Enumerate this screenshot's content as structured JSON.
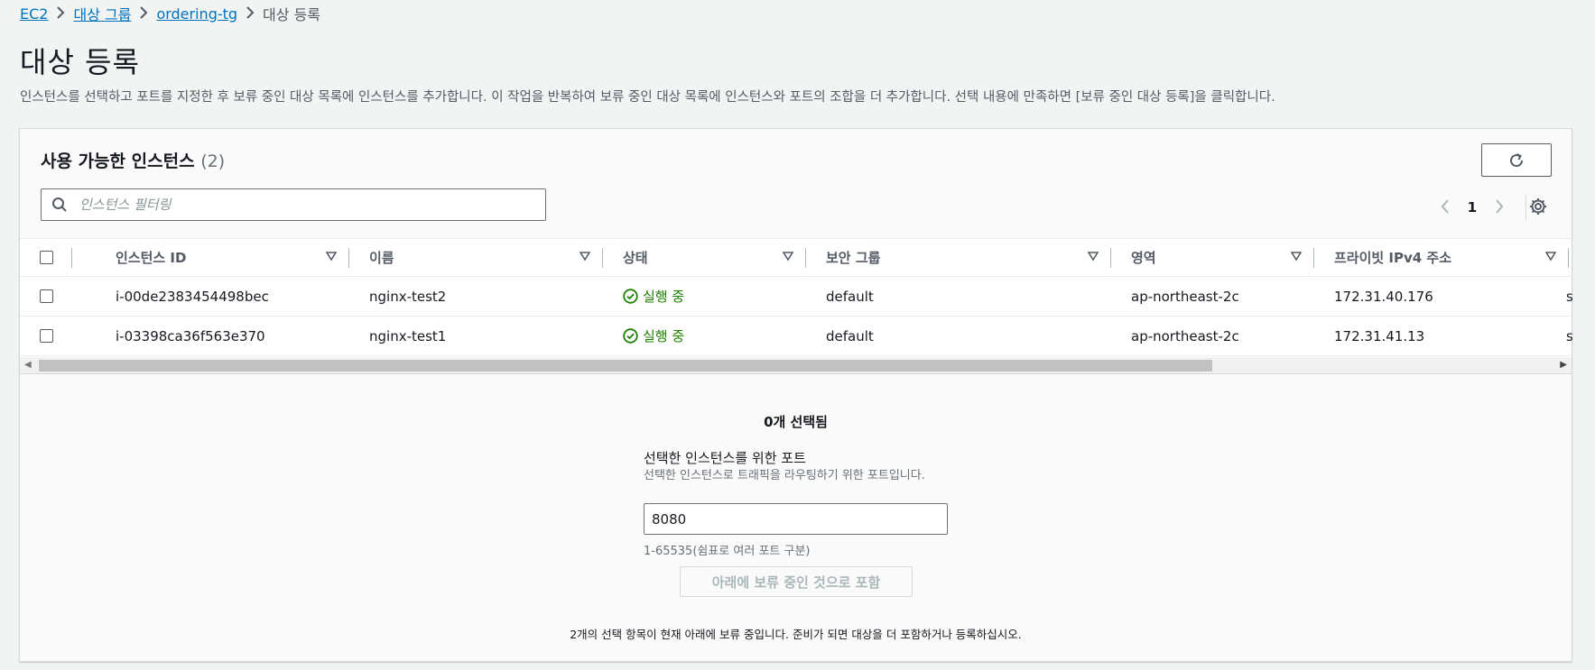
{
  "breadcrumb": {
    "items": [
      "EC2",
      "대상 그룹",
      "ordering-tg"
    ],
    "current": "대상 등록"
  },
  "page": {
    "title": "대상 등록",
    "description": "인스턴스를 선택하고 포트를 지정한 후 보류 중인 대상 목록에 인스턴스를 추가합니다. 이 작업을 반복하여 보류 중인 대상 목록에 인스턴스와 포트의 조합을 더 추가합니다. 선택 내용에 만족하면 [보류 중인 대상 등록]을 클릭합니다."
  },
  "panel": {
    "title": "사용 가능한 인스턴스",
    "count": "(2)",
    "search_placeholder": "인스턴스 필터링",
    "page_number": "1"
  },
  "table": {
    "columns": [
      "인스턴스 ID",
      "이름",
      "상태",
      "보안 그룹",
      "영역",
      "프라이빗 IPv4 주소"
    ],
    "rows": [
      {
        "id": "i-00de2383454498bec",
        "name": "nginx-test2",
        "state": "실행 중",
        "sg": "default",
        "zone": "ap-northeast-2c",
        "ip": "172.31.40.176",
        "extra": "s"
      },
      {
        "id": "i-03398ca36f563e370",
        "name": "nginx-test1",
        "state": "실행 중",
        "sg": "default",
        "zone": "ap-northeast-2c",
        "ip": "172.31.41.13",
        "extra": "s"
      }
    ]
  },
  "selection": {
    "selected_count": "0개 선택됨",
    "port_label": "선택한 인스턴스를 위한 포트",
    "port_desc": "선택한 인스턴스로 트래픽을 라우팅하기 위한 포트입니다.",
    "port_value": "8080",
    "port_hint": "1-65535(쉼표로 여러 포트 구분)",
    "include_button": "아래에 보류 중인 것으로 포함",
    "pending_note": "2개의 선택 항목이 현재 아래에 보류 중입니다. 준비가 되면 대상을 더 포함하거나 등록하십시오."
  },
  "colors": {
    "link": "#0073bb",
    "success": "#1d8102",
    "background": "#f2f3f3"
  }
}
